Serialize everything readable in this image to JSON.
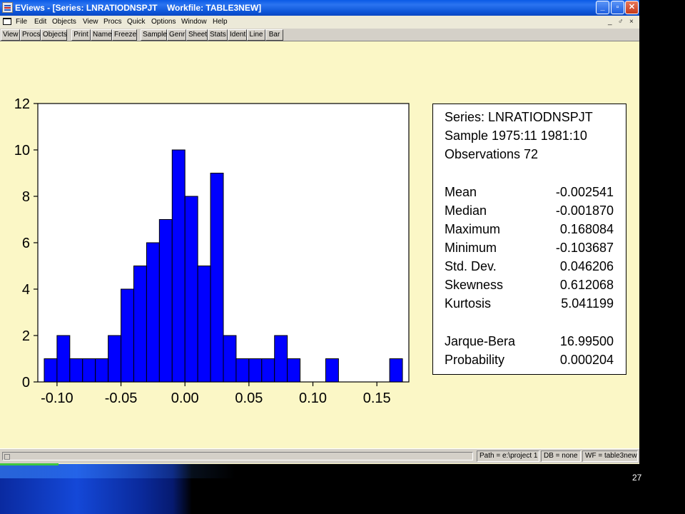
{
  "window": {
    "title": "EViews - [Series: LNRATIODNSPJT    Workfile: TABLE3NEW]",
    "controls": {
      "minimize": "_",
      "maximize": "▫",
      "close": "✕"
    }
  },
  "menubar": {
    "items": [
      "File",
      "Edit",
      "Objects",
      "View",
      "Procs",
      "Quick",
      "Options",
      "Window",
      "Help"
    ],
    "mdi_controls": [
      "_",
      "♂",
      "×"
    ]
  },
  "toolbar": {
    "buttons": [
      "View",
      "Procs",
      "Objects",
      "Print",
      "Name",
      "Freeze",
      "Sample",
      "Genr",
      "Sheet",
      "Stats",
      "Ident",
      "Line",
      "Bar"
    ]
  },
  "chart_data": {
    "type": "bar",
    "title": "",
    "xlabel": "",
    "ylabel": "",
    "bar_color": "#0000ff",
    "bin_width": 0.01,
    "bins_start": [
      -0.11,
      -0.1,
      -0.09,
      -0.08,
      -0.07,
      -0.06,
      -0.05,
      -0.04,
      -0.03,
      -0.02,
      -0.01,
      0.0,
      0.01,
      0.02,
      0.03,
      0.04,
      0.05,
      0.06,
      0.07,
      0.08,
      0.09,
      0.1,
      0.11,
      0.12,
      0.13,
      0.14,
      0.15,
      0.16
    ],
    "values": [
      1,
      2,
      1,
      1,
      1,
      2,
      4,
      5,
      6,
      7,
      10,
      8,
      5,
      9,
      2,
      1,
      1,
      1,
      2,
      1,
      0,
      0,
      1,
      0,
      0,
      0,
      0,
      1
    ],
    "xlim": [
      -0.115,
      0.175
    ],
    "ylim": [
      0,
      12
    ],
    "x_ticks": [
      -0.1,
      -0.05,
      0.0,
      0.05,
      0.1,
      0.15
    ],
    "x_tick_labels": [
      "-0.10",
      "-0.05",
      "0.00",
      "0.05",
      "0.10",
      "0.15"
    ],
    "y_ticks": [
      0,
      2,
      4,
      6,
      8,
      10,
      12
    ],
    "y_tick_labels": [
      "0",
      "2",
      "4",
      "6",
      "8",
      "10",
      "12"
    ]
  },
  "stats": {
    "series_line": "Series: LNRATIODNSPJT",
    "sample_line": "Sample 1975:11 1981:10",
    "observations_line": "Observations 72",
    "rows": [
      {
        "label": "Mean",
        "value": "-0.002541"
      },
      {
        "label": "Median",
        "value": "-0.001870"
      },
      {
        "label": "Maximum",
        "value": "0.168084"
      },
      {
        "label": "Minimum",
        "value": "-0.103687"
      },
      {
        "label": "Std. Dev.",
        "value": "0.046206"
      },
      {
        "label": "Skewness",
        "value": "0.612068"
      },
      {
        "label": "Kurtosis",
        "value": "5.041199"
      }
    ],
    "tests": [
      {
        "label": "Jarque-Bera",
        "value": "16.99500"
      },
      {
        "label": "Probability",
        "value": "0.000204"
      }
    ]
  },
  "statusbar": {
    "path": "Path = e:\\project 1",
    "db": "DB = none",
    "wf": "WF = table3new"
  },
  "slide_number": "27"
}
